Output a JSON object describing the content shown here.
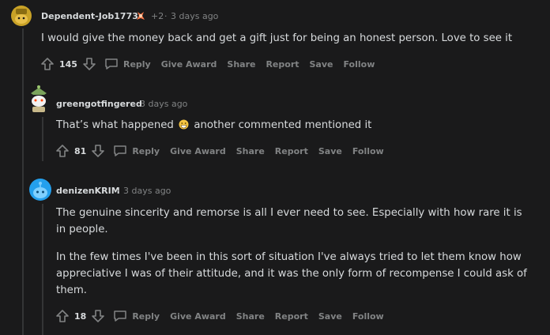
{
  "comments": [
    {
      "username": "Dependent-Job1773",
      "karma_badge": "+2",
      "time": "3 days ago",
      "text": "I would give the money back and get a gift just for being an honest person. Love to see it",
      "score": "145"
    },
    {
      "username": "greengotfingered",
      "time": "3 days ago",
      "text_before": "That’s what happened",
      "text_after": "another commented mentioned it",
      "score": "81"
    },
    {
      "username": "denizenKRIM",
      "time": "3 days ago",
      "para1": "The genuine sincerity and remorse is all I ever need to see. Especially with how rare it is in people.",
      "para2": "In the few times I've been in this sort of situation I've always tried to let them know how appreciative I was of their attitude, and it was the only form of recompense I could ask of them.",
      "score": "18"
    }
  ],
  "actions": {
    "reply": "Reply",
    "give_award": "Give Award",
    "share": "Share",
    "report": "Report",
    "save": "Save",
    "follow": "Follow"
  },
  "separator": "·",
  "icons": [
    "upvote-icon",
    "downvote-icon",
    "reply-icon",
    "award-icon",
    "grin-emoji-icon"
  ],
  "colors": {
    "background": "#1a1a1b",
    "text": "#d7dadc",
    "muted": "#818384",
    "thread_line": "#343536",
    "avatar1": "#c9a227",
    "avatar3": "#24a0ed"
  }
}
